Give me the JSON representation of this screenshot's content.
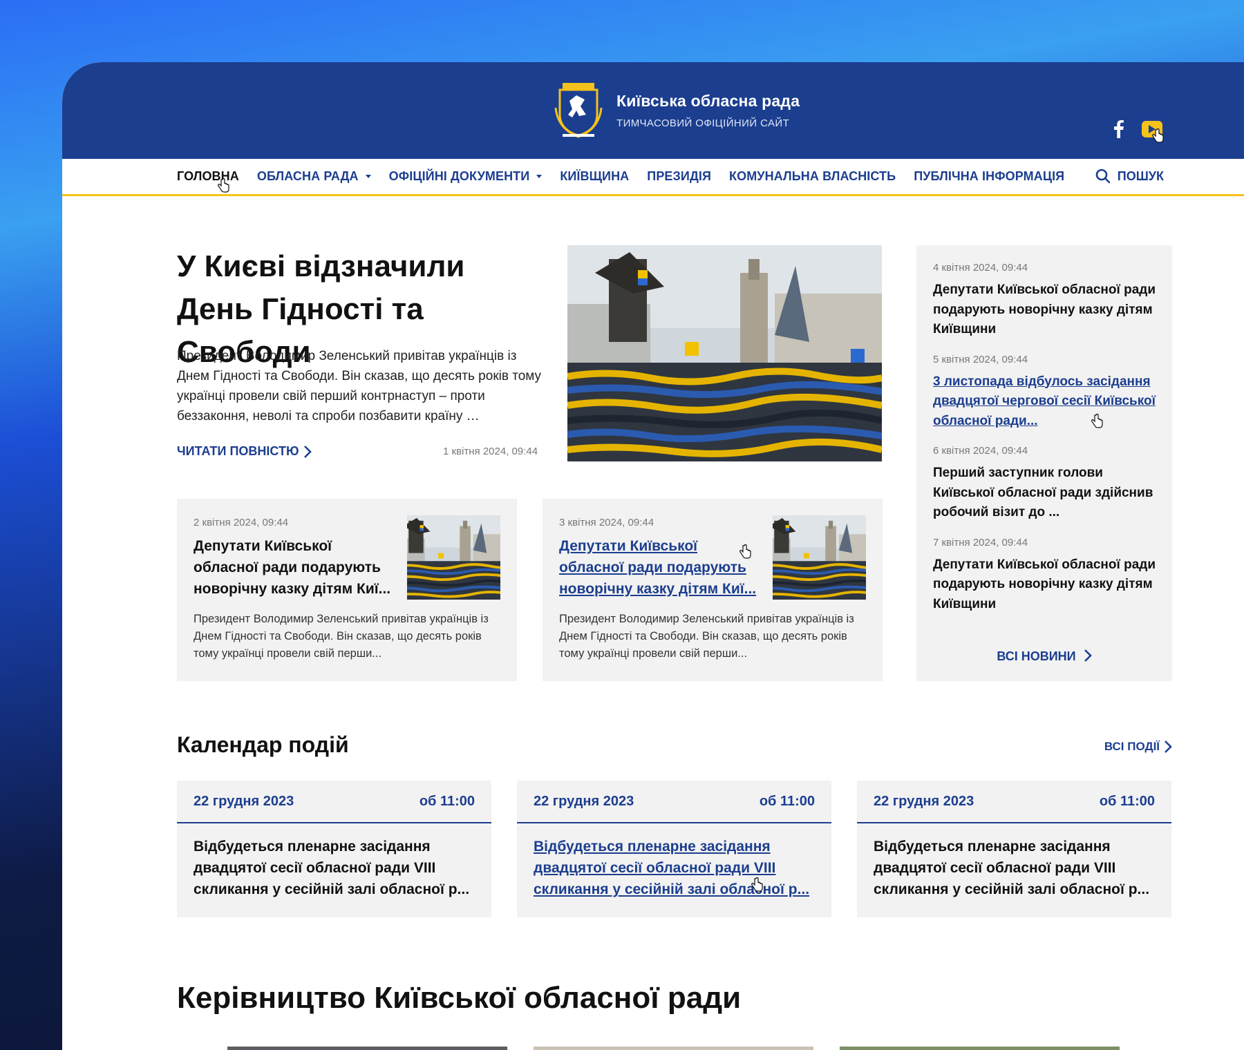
{
  "header": {
    "title": "Київська обласна рада",
    "subtitle": "ТИМЧАСОВИЙ ОФІЦІЙНИЙ САЙТ",
    "social": [
      "facebook-icon",
      "youtube-icon"
    ]
  },
  "nav": {
    "items": [
      {
        "label": "ГОЛОВНА"
      },
      {
        "label": "ОБЛАСНА РАДА"
      },
      {
        "label": "ОФІЦІЙНІ ДОКУМЕНТИ"
      },
      {
        "label": "КИЇВЩИНА"
      },
      {
        "label": "ПРЕЗИДІЯ"
      },
      {
        "label": "КОМУНАЛЬНА ВЛАСНІСТЬ"
      },
      {
        "label": "ПУБЛІЧНА ІНФОРМАЦІЯ"
      }
    ],
    "search_label": "ПОШУК"
  },
  "hero": {
    "title": "У Києві відзначили День Гідності та Свободи",
    "text": "Президент Володимир Зеленський привітав українців із Днем Гідності та Свободи. Він сказав, що десять років тому українці провели свій перший контрнаступ – проти беззаконня, неволі та спроби позбавити країну …",
    "read_more": "ЧИТАТИ ПОВНІСТЮ",
    "date": "1 квітня 2024, 09:44"
  },
  "cards": [
    {
      "date": "2 квітня 2024, 09:44",
      "title": "Депутати Київської обласної ради подарують новорічну казку дітям Киї...",
      "excerpt": "Президент Володимир Зеленський привітав українців із Днем Гідності та Свободи. Він сказав, що десять років тому українці провели свій перши..."
    },
    {
      "date": "3 квітня 2024, 09:44",
      "title": "Депутати Київської обласної ради подарують новорічну казку дітям Киї...",
      "excerpt": "Президент Володимир Зеленський привітав українців із Днем Гідності та Свободи. Він сказав, що десять років тому українці провели свій перши..."
    }
  ],
  "side_news": {
    "items": [
      {
        "date": "4 квітня 2024, 09:44",
        "title": "Депутати Київської обласної ради подарують новорічну казку дітям Київщини"
      },
      {
        "date": "5 квітня 2024, 09:44",
        "title": "3 листопада відбулось засідання двадцятої чергової сесії Київської обласної ради..."
      },
      {
        "date": "6 квітня 2024, 09:44",
        "title": "Перший заступник голови Київської обласної ради здійснив робочий візит до ..."
      },
      {
        "date": "7 квітня 2024, 09:44",
        "title": "Депутати Київської обласної ради подарують новорічну казку дітям Київщини"
      }
    ],
    "all_label": "ВСІ НОВИНИ"
  },
  "events": {
    "title": "Календар подій",
    "all_label": "ВСІ ПОДІЇ",
    "items": [
      {
        "date": "22 грудня 2023",
        "time": "об 11:00",
        "text": "Відбудеться пленарне засідання двадцятої сесії обласної ради VIII скликання у сесійній залі обласної р..."
      },
      {
        "date": "22 грудня 2023",
        "time": "об 11:00",
        "text": "Відбудеться пленарне засідання двадцятої сесії обласної ради VIII скликання у сесійній залі обласної р..."
      },
      {
        "date": "22 грудня 2023",
        "time": "об 11:00",
        "text": "Відбудеться пленарне засідання двадцятої сесії обласної ради VIII скликання у сесійній залі обласної р..."
      }
    ]
  },
  "leaders": {
    "title": "Керівництво Київської обласної ради"
  },
  "colors": {
    "brand_blue": "#1c3e8f",
    "accent_yellow": "#f4c21b",
    "card_bg": "#f2f2f2"
  }
}
